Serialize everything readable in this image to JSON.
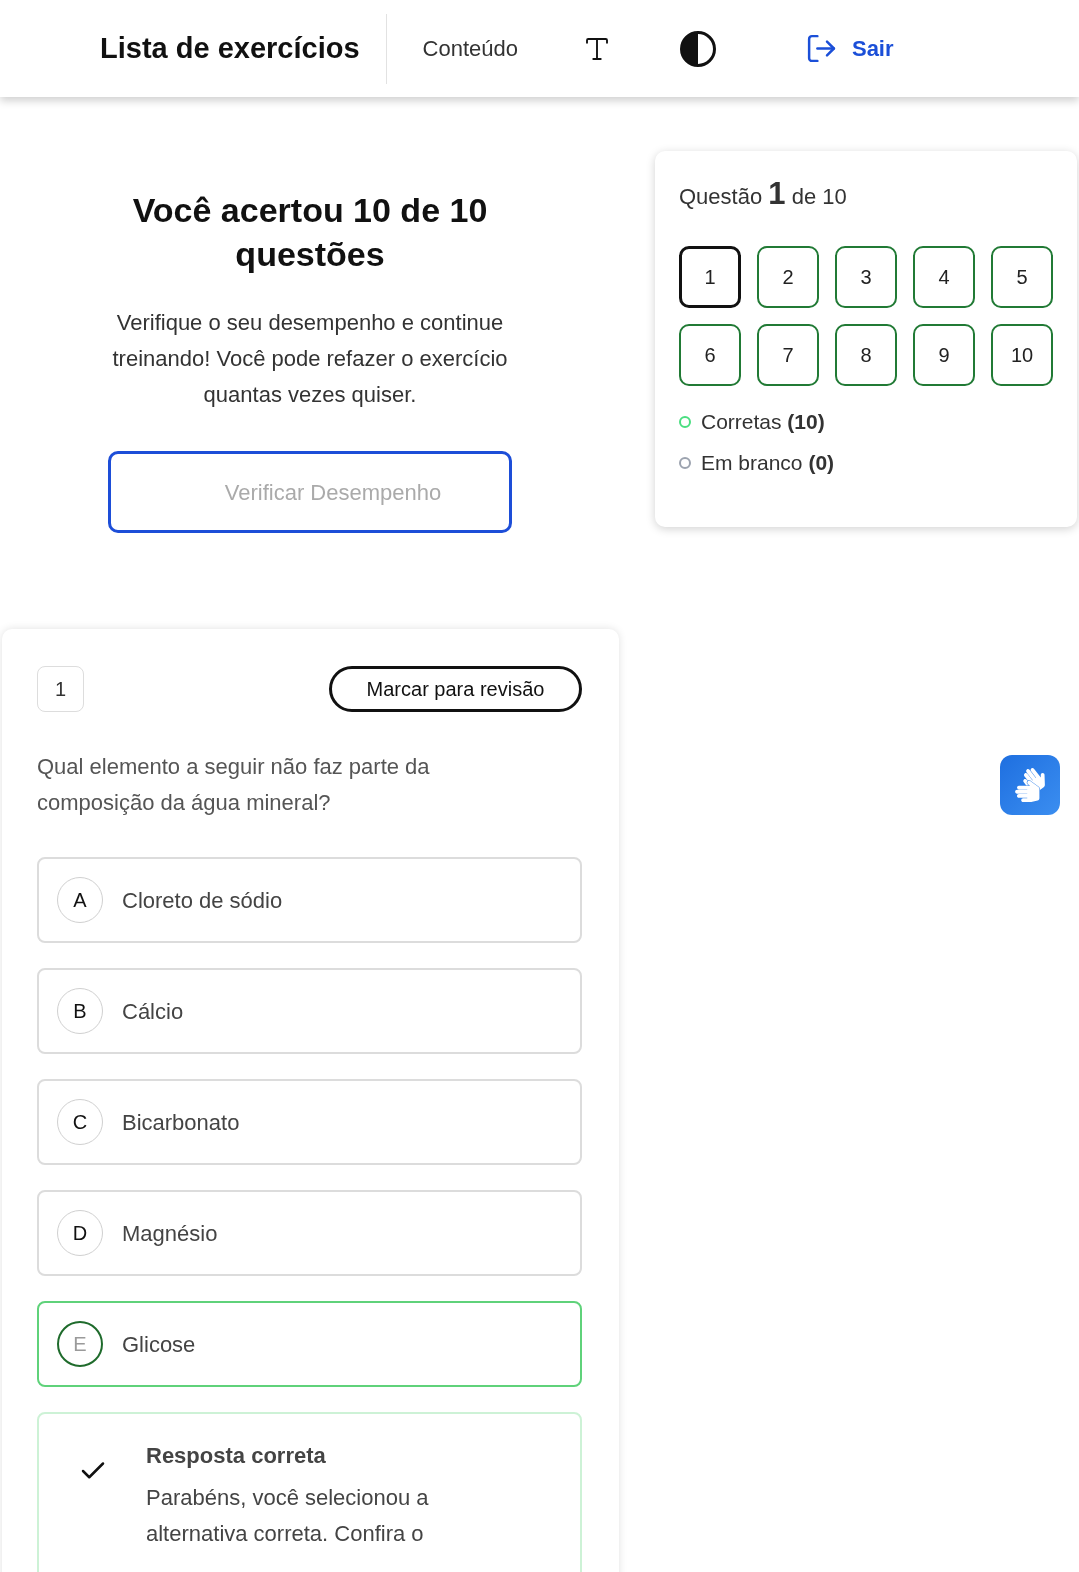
{
  "header": {
    "title": "Lista de exercícios",
    "content_link": "Conteúdo",
    "logout": "Sair"
  },
  "result": {
    "title": "Você acertou 10 de 10 questões",
    "message": "Verifique o seu desempenho e continue treinando! Você pode refazer o exercício quantas vezes quiser.",
    "button": "Verificar Desempenho"
  },
  "navigator": {
    "heading": "Questão **1** de 10",
    "questions": [
      {
        "label": "1",
        "selected": true
      },
      {
        "label": "2",
        "selected": false
      },
      {
        "label": "3",
        "selected": false
      },
      {
        "label": "4",
        "selected": false
      },
      {
        "label": "5",
        "selected": false
      },
      {
        "label": "6",
        "selected": false
      },
      {
        "label": "7",
        "selected": false
      },
      {
        "label": "8",
        "selected": false
      },
      {
        "label": "9",
        "selected": false
      },
      {
        "label": "10",
        "selected": false
      }
    ],
    "legend": [
      {
        "label": "Corretas **(10)**",
        "color": "#4ade80"
      },
      {
        "label": "Em branco **(0)**",
        "color": "#9ca3af"
      }
    ]
  },
  "question": {
    "number": "1",
    "review_button": "Marcar para revisão",
    "text": "Qual elemento a seguir não faz parte da composição da água mineral?",
    "options": [
      {
        "letter": "A",
        "label": "Cloreto de sódio",
        "selected": false
      },
      {
        "letter": "B",
        "label": "Cálcio",
        "selected": false
      },
      {
        "letter": "C",
        "label": "Bicarbonato",
        "selected": false
      },
      {
        "letter": "D",
        "label": "Magnésio",
        "selected": false
      },
      {
        "letter": "E",
        "label": "Glicose",
        "selected": true
      }
    ],
    "feedback": {
      "title": "Resposta correta",
      "message": "Parabéns, você selecionou a alternativa correta. Confira o"
    }
  }
}
